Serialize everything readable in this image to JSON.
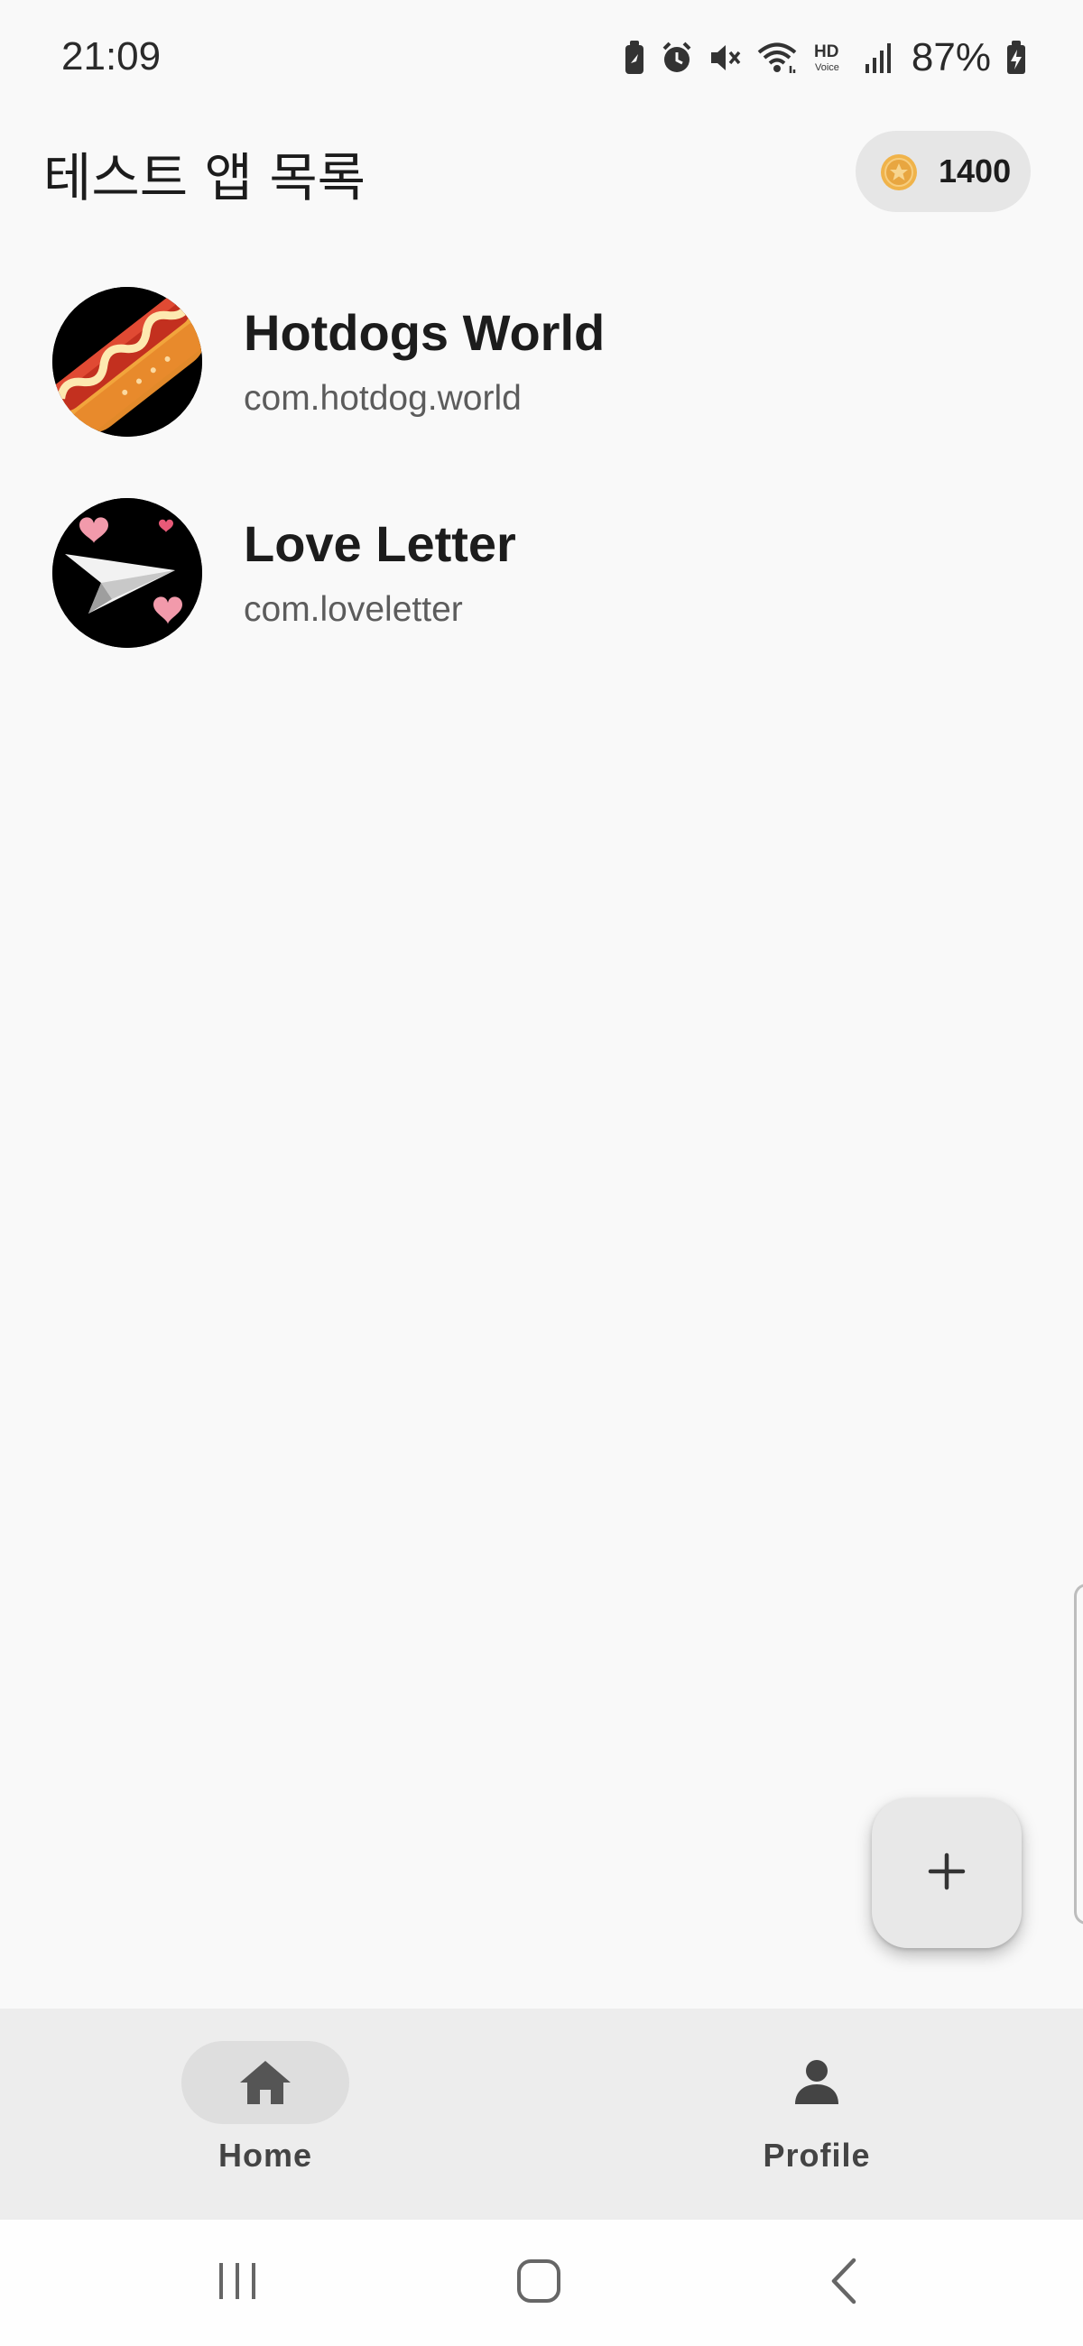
{
  "status_bar": {
    "time": "21:09",
    "battery_percent": "87%",
    "icons": [
      "battery-saver-icon",
      "alarm-icon",
      "mute-icon",
      "wifi-icon",
      "hd-voice-icon",
      "signal-icon",
      "battery-charging-icon"
    ]
  },
  "header": {
    "title": "테스트 앱 목록",
    "coin_balance": "1400",
    "coin_icon": "coin-icon"
  },
  "apps": [
    {
      "name": "Hotdogs World",
      "package": "com.hotdog.world",
      "icon": "hotdog-icon"
    },
    {
      "name": "Love Letter",
      "package": "com.loveletter",
      "icon": "paper-plane-hearts-icon"
    }
  ],
  "fab": {
    "icon": "plus-icon"
  },
  "bottom_nav": {
    "items": [
      {
        "label": "Home",
        "icon": "home-icon",
        "selected": true
      },
      {
        "label": "Profile",
        "icon": "person-icon",
        "selected": false
      }
    ]
  },
  "system_nav": {
    "buttons": [
      "recents-icon",
      "home-button-icon",
      "back-icon"
    ]
  },
  "colors": {
    "background": "#f9f9f9",
    "bottom_nav_bg": "#ededed",
    "selected_pill": "#dedede",
    "coin_chip": "#e6e6e6",
    "coin_gold": "#e8a640"
  }
}
